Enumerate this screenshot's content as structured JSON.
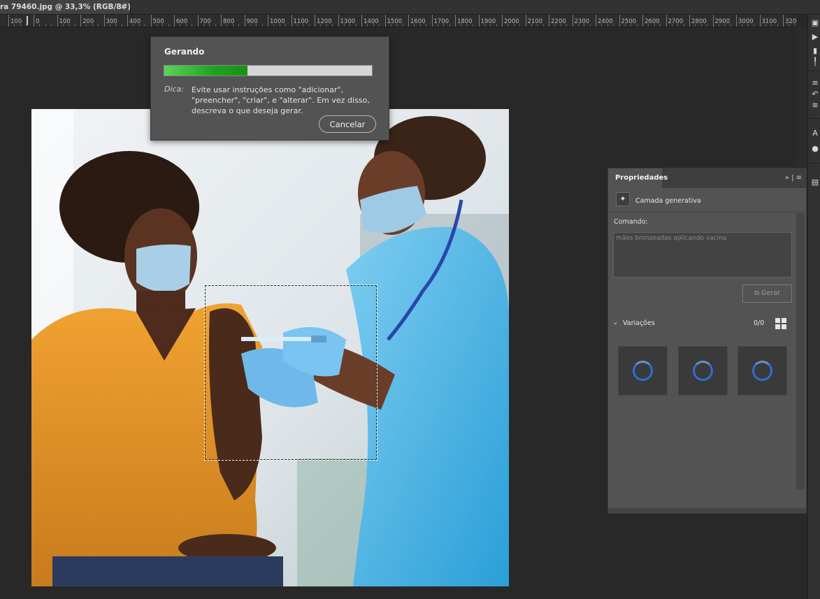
{
  "document_tab": {
    "title": "ra 79460.jpg @ 33,3% (RGB/8#)",
    "close_glyph": "×"
  },
  "ruler": {
    "labels": [
      "100",
      "0",
      "100",
      "200",
      "300",
      "400",
      "500",
      "600",
      "700",
      "800",
      "900",
      "1000",
      "1100",
      "1200",
      "1300",
      "1400",
      "1500",
      "1600",
      "1700",
      "1800",
      "1900",
      "2000",
      "2100",
      "2200",
      "2300",
      "2400",
      "2500",
      "2600",
      "2700",
      "2800",
      "2900",
      "3000",
      "3100",
      "3200"
    ]
  },
  "generating_dialog": {
    "title": "Gerando",
    "progress_percent": 40,
    "tip_label": "Dica:",
    "tip_text": "Evite usar instruções como \"adicionar\", \"preencher\", \"criar\", e \"alterar\". Em vez disso, descreva o que deseja gerar.",
    "cancel_label": "Cancelar"
  },
  "properties_panel": {
    "tab_label": "Propriedades",
    "header_icons": "»  |  ≡",
    "layer_name": "Camada generativa",
    "command_label": "Comando:",
    "command_text": "mãos bronzeadas aplicando vacina",
    "generate_label": "Gerar",
    "variations_label": "Variações",
    "variations_count": "0/0",
    "thumbnail_count": 3
  },
  "colors": {
    "accent_progress": "#1fa31f",
    "spinner_blue": "#2a6fd6",
    "panel_bg": "#535353",
    "workspace_bg": "#282828"
  },
  "icons": {
    "layer": "generative-layer-icon",
    "generate": "generate-icon",
    "grid": "grid-view-icon",
    "chevron": "chevron-down-icon"
  }
}
